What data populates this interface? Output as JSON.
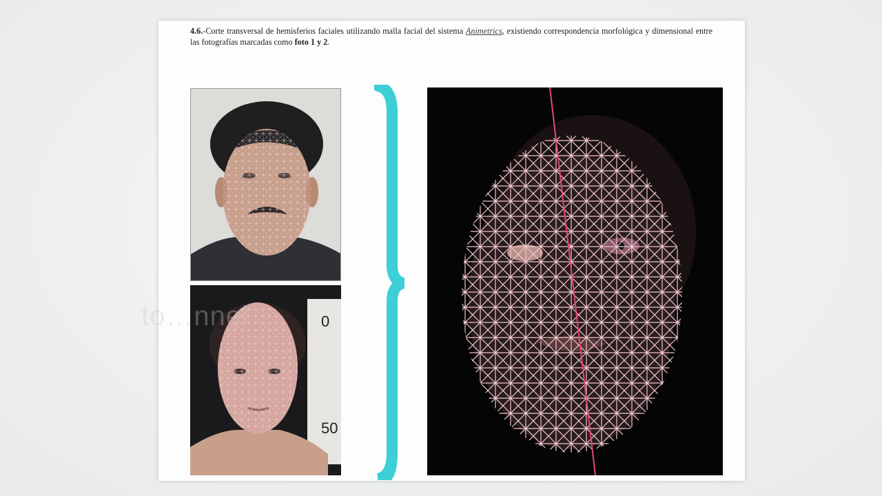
{
  "document": {
    "section_number": "4.6.",
    "caption_part1": "-Corte transversal de hemisferios faciales utilizando malla facial del sistema ",
    "software_name": "Animetrics",
    "caption_part2": ", existiendo correspondencia morfológica y dimensional entre las fotografías marcadas como ",
    "photo_ref": "foto 1 y 2",
    "caption_end": "."
  },
  "figures": {
    "photo1_desc": "mugshot-with-facial-mesh-1",
    "photo2_desc": "mugshot-with-facial-mesh-2",
    "overlay_desc": "facial-mesh-overlay-comparison"
  },
  "colors": {
    "brace": "#3ccfd8",
    "mesh": "#f2c6cf",
    "midline": "#e8457d"
  },
  "watermark": "to…nnel"
}
